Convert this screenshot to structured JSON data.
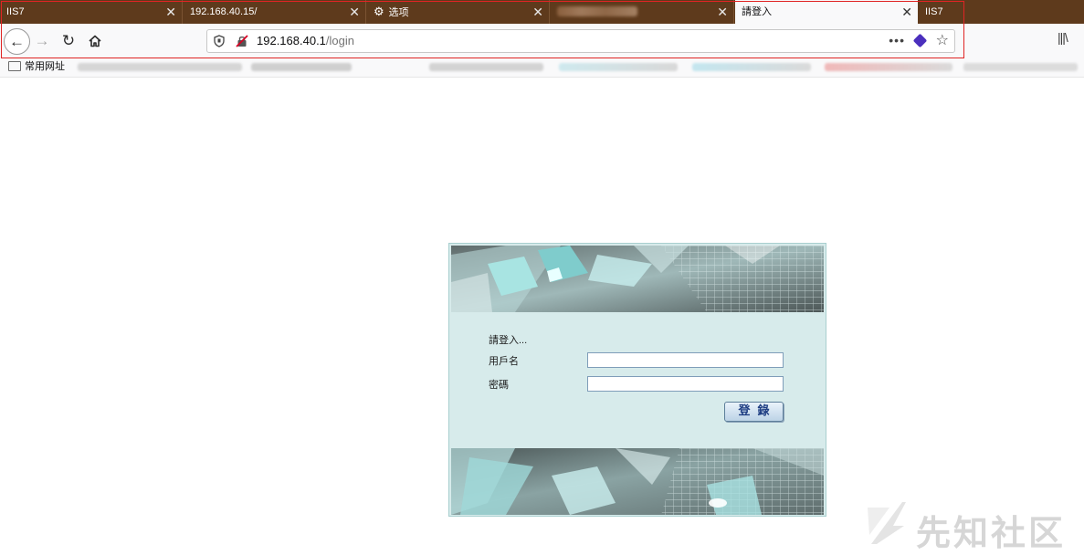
{
  "browser": {
    "tabs": [
      {
        "title": "IIS7",
        "active": false
      },
      {
        "title": "192.168.40.15/",
        "active": false
      },
      {
        "title": "选项",
        "icon": "gear-icon",
        "active": false
      },
      {
        "title": "",
        "active": false
      },
      {
        "title": "請登入",
        "active": true
      },
      {
        "title": "IIS7",
        "active": false
      }
    ],
    "close_glyph": "✕",
    "address": {
      "host": "192.168.40.1",
      "path": "/login",
      "more_glyph": "•••"
    },
    "bookmarks": {
      "folder_label": "常用网址"
    },
    "colors": {
      "tab_strip": "#5e3a1c",
      "toolbar": "#f9f9fa",
      "highlight_box": "#e02424"
    }
  },
  "login": {
    "prompt": "請登入...",
    "username_label": "用戶名",
    "password_label": "密碼",
    "username_value": "",
    "password_value": "",
    "submit_label": "登錄",
    "colors": {
      "panel_bg": "#d7ebeb",
      "button_text": "#1f3e83"
    }
  },
  "watermark": {
    "text": "先知社区"
  }
}
